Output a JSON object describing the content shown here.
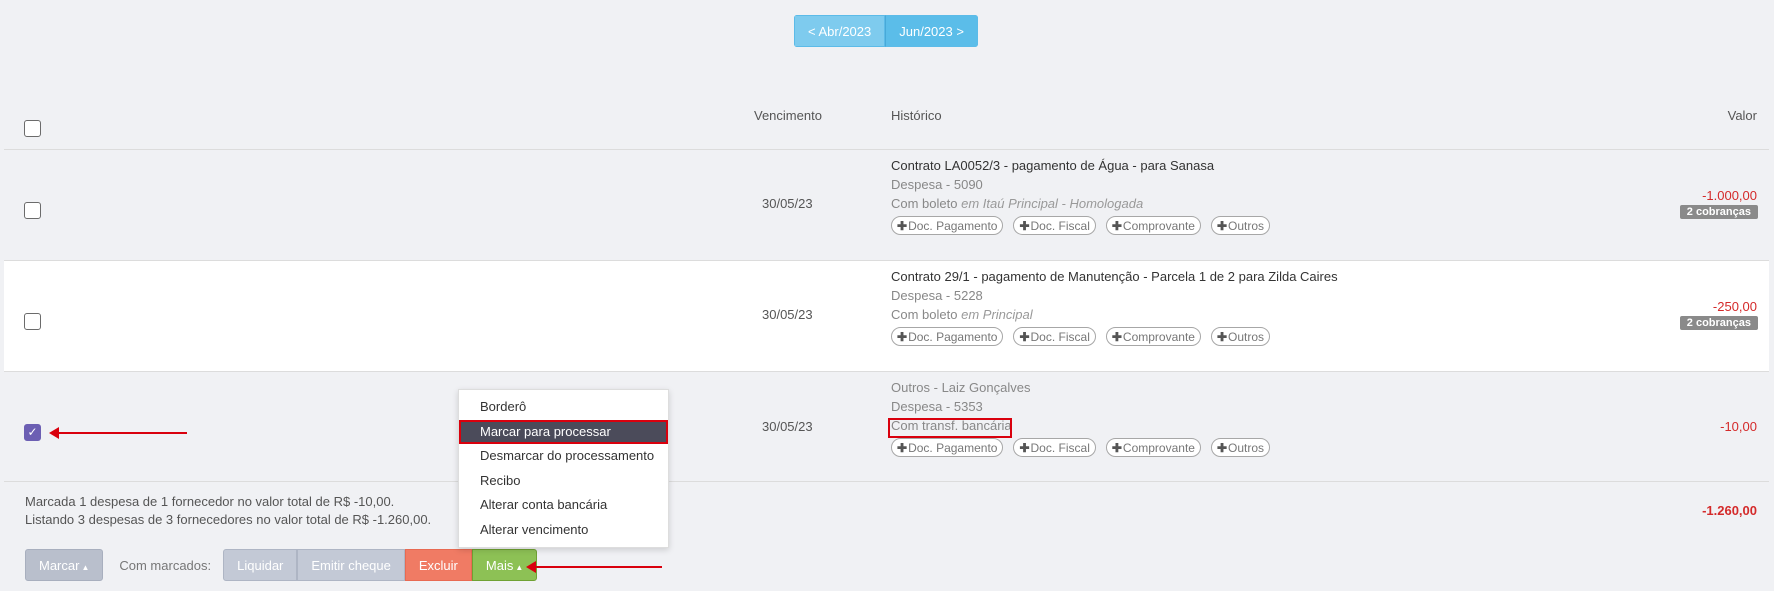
{
  "period_nav": {
    "prev": "< Abr/2023",
    "next": "Jun/2023 >"
  },
  "columns": {
    "vencimento": "Vencimento",
    "historico": "Histórico",
    "valor": "Valor"
  },
  "rows": [
    {
      "date": "30/05/23",
      "title": "Contrato LA0052/3 - pagamento de Água - para Sanasa",
      "despesa": "Despesa - 5090",
      "method": "Com boleto",
      "bank": "em Itaú Principal - Homologada",
      "valor": "-1.000,00",
      "badge": "2 cobranças",
      "checked": false
    },
    {
      "date": "30/05/23",
      "title": "Contrato 29/1 - pagamento de Manutenção - Parcela 1 de 2 para Zilda Caires",
      "despesa": "Despesa - 5228",
      "method": "Com boleto",
      "bank": "em Principal",
      "valor": "-250,00",
      "badge": "2 cobranças",
      "checked": false
    },
    {
      "date": "30/05/23",
      "title": "Outros - Laiz Gonçalves",
      "despesa": "Despesa - 5353",
      "method": "Com transf. bancária",
      "bank": "",
      "valor": "-10,00",
      "badge": "",
      "checked": true
    }
  ],
  "chips": {
    "doc_pagamento": "Doc. Pagamento",
    "doc_fiscal": "Doc. Fiscal",
    "comprovante": "Comprovante",
    "outros": "Outros"
  },
  "summary": {
    "line1": "Marcada 1 despesa de 1 fornecedor no valor total de R$ -10,00.",
    "line2": "Listando 3 despesas de 3 fornecedores no valor total de R$ -1.260,00.",
    "total": "-1.260,00"
  },
  "toolbar": {
    "marcar": "Marcar",
    "com_marcados": "Com marcados:",
    "liquidar": "Liquidar",
    "emitir_cheque": "Emitir cheque",
    "excluir": "Excluir",
    "mais": "Mais"
  },
  "dropdown": {
    "items": [
      "Borderô",
      "Marcar para processar",
      "Desmarcar do processamento",
      "Recibo",
      "Alterar conta bancária",
      "Alterar vencimento"
    ],
    "active_index": 1
  },
  "colors": {
    "accent_purple": "#6c5fb3",
    "negative": "#d42a2a",
    "highlight": "#d9000d"
  }
}
